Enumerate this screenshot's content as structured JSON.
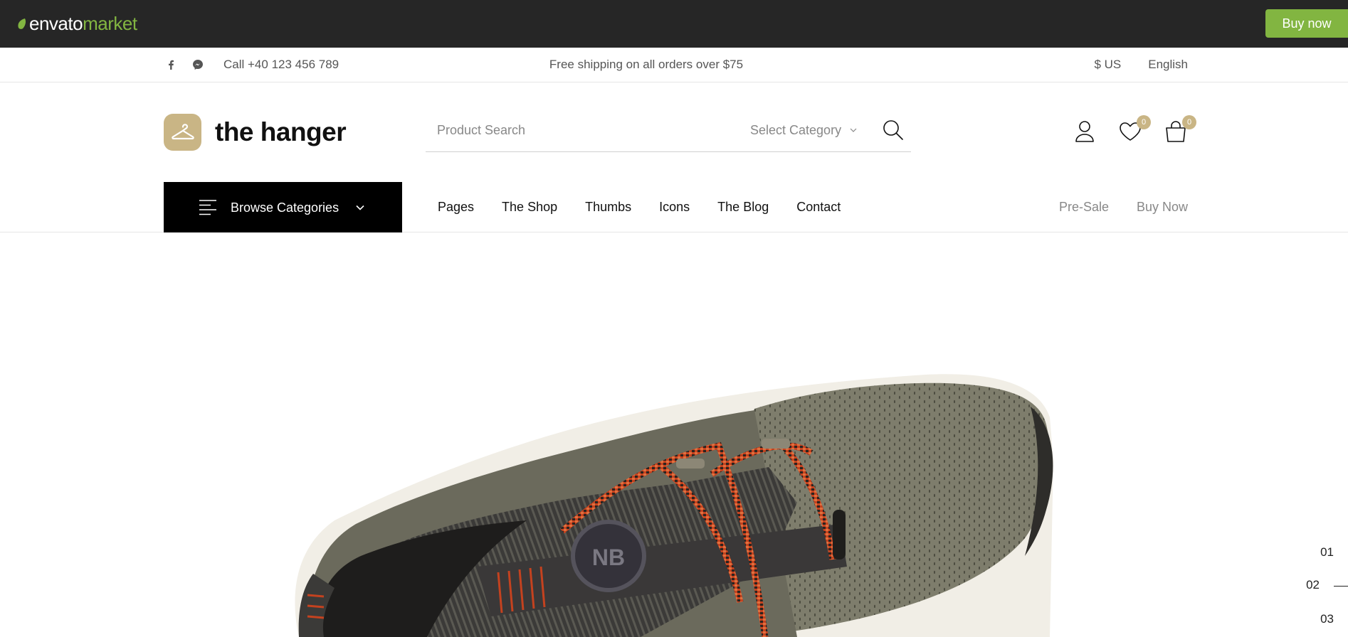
{
  "envato": {
    "logo_part1": "envato",
    "logo_part2": "market",
    "buy_now": "Buy now",
    "accent": "#82b541"
  },
  "utility": {
    "phone": "Call +40 123 456 789",
    "shipping": "Free shipping on all orders over $75",
    "currency": "$ US",
    "language": "English",
    "icons": [
      "facebook-icon",
      "messenger-icon"
    ]
  },
  "header": {
    "logo_text": "the hanger",
    "brand_color": "#c9b585",
    "search_placeholder": "Product Search",
    "category_label": "Select Category",
    "wishlist_count": "0",
    "cart_count": "0"
  },
  "nav": {
    "browse_label": "Browse Categories",
    "items": [
      "Pages",
      "The Shop",
      "Thumbs",
      "Icons",
      "The Blog",
      "Contact"
    ],
    "right_items": [
      "Pre-Sale",
      "Buy Now"
    ]
  },
  "slider": {
    "numbers": [
      "01",
      "02",
      "03"
    ],
    "active": "02"
  }
}
